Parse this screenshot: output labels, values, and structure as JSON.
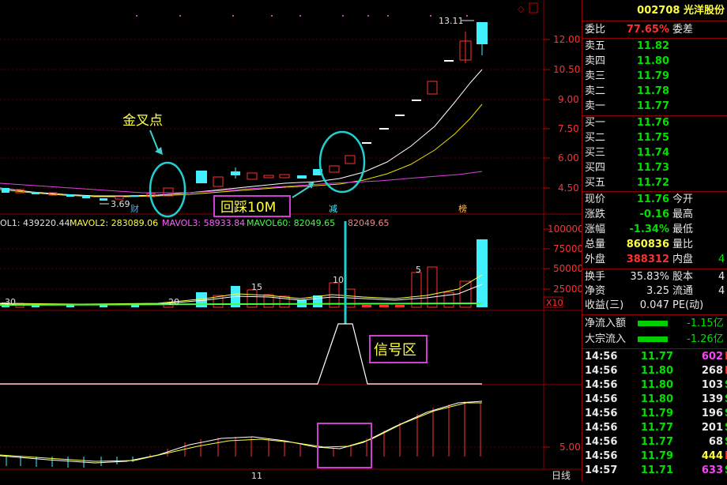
{
  "stock": {
    "code": "002708",
    "name": "光洋股份"
  },
  "bid_ratio": {
    "label": "委比",
    "value": "77.65%",
    "label2": "委差"
  },
  "asks": [
    {
      "label": "卖五",
      "price": "11.82"
    },
    {
      "label": "卖四",
      "price": "11.80"
    },
    {
      "label": "卖三",
      "price": "11.79"
    },
    {
      "label": "卖二",
      "price": "11.78"
    },
    {
      "label": "卖一",
      "price": "11.77"
    }
  ],
  "bids": [
    {
      "label": "买一",
      "price": "11.76"
    },
    {
      "label": "买二",
      "price": "11.75"
    },
    {
      "label": "买三",
      "price": "11.74"
    },
    {
      "label": "买四",
      "price": "11.73"
    },
    {
      "label": "买五",
      "price": "11.72"
    }
  ],
  "quote": [
    {
      "label": "现价",
      "value": "11.76",
      "label2": "今开",
      "cls": "g"
    },
    {
      "label": "涨跌",
      "value": "-0.16",
      "label2": "最高",
      "cls": "g"
    },
    {
      "label": "涨幅",
      "value": "-1.34%",
      "label2": "最低",
      "cls": "g"
    },
    {
      "label": "总量",
      "value": "860836",
      "label2": "量比",
      "cls": "y"
    },
    {
      "label": "外盘",
      "value": "388312",
      "label2": "内盘",
      "cls": "r",
      "value2": "4"
    }
  ],
  "stats": [
    {
      "label": "换手",
      "value": "35.83%",
      "label2": "股本",
      "value2": "4"
    },
    {
      "label": "净资",
      "value": "3.25",
      "label2": "流通",
      "value2": "4"
    },
    {
      "label": "收益(三)",
      "value": "0.047",
      "label2": "PE(动)",
      "value2": ""
    }
  ],
  "flows": [
    {
      "label": "净流入额",
      "value": "-1.15亿"
    },
    {
      "label": "大宗流入",
      "value": "-1.26亿"
    }
  ],
  "ticks": [
    {
      "time": "14:56",
      "price": "11.77",
      "vol": "602",
      "side": "B",
      "pc": "g",
      "vc": "m"
    },
    {
      "time": "14:56",
      "price": "11.80",
      "vol": "268",
      "side": "B",
      "pc": "g",
      "vc": "w"
    },
    {
      "time": "14:56",
      "price": "11.80",
      "vol": "103",
      "side": "S",
      "pc": "g",
      "vc": "w"
    },
    {
      "time": "14:56",
      "price": "11.80",
      "vol": "139",
      "side": "S",
      "pc": "g",
      "vc": "w"
    },
    {
      "time": "14:56",
      "price": "11.79",
      "vol": "196",
      "side": "S",
      "pc": "g",
      "vc": "w"
    },
    {
      "time": "14:56",
      "price": "11.77",
      "vol": "201",
      "side": "S",
      "pc": "g",
      "vc": "w"
    },
    {
      "time": "14:56",
      "price": "11.77",
      "vol": "68",
      "side": "S",
      "pc": "g",
      "vc": "w"
    },
    {
      "time": "14:56",
      "price": "11.79",
      "vol": "444",
      "side": "B",
      "pc": "g",
      "vc": "y"
    },
    {
      "time": "14:57",
      "price": "11.71",
      "vol": "633",
      "side": "S",
      "pc": "g",
      "vc": "m"
    }
  ],
  "chart": {
    "price_axis": [
      "12.00",
      "10.50",
      "9.00",
      "7.50",
      "6.00",
      "4.50"
    ],
    "high_label": "13.11",
    "low_label": "3.69",
    "markers": [
      "财",
      "减",
      "榜"
    ],
    "mavol_legend": {
      "vol": "OL1: 439220.44",
      "mavol2": "MAVOL2: 283089.06",
      "mavol3": "MAVOL3: 58933.84",
      "mavol60": "MAVOL60: 82049.65",
      "extra": "82049.65"
    },
    "vol_axis": [
      "100000",
      "75000",
      "50000",
      "25000"
    ],
    "vol_unit": "X10",
    "vol_counts": [
      "30",
      "20",
      "15",
      "10",
      "5"
    ],
    "macd_axis": "5.00",
    "bottom_axis": "11",
    "period": "日线",
    "annotations": {
      "golden_cross": "金叉点",
      "pullback": "回踩10M",
      "signal": "信号区"
    }
  }
}
